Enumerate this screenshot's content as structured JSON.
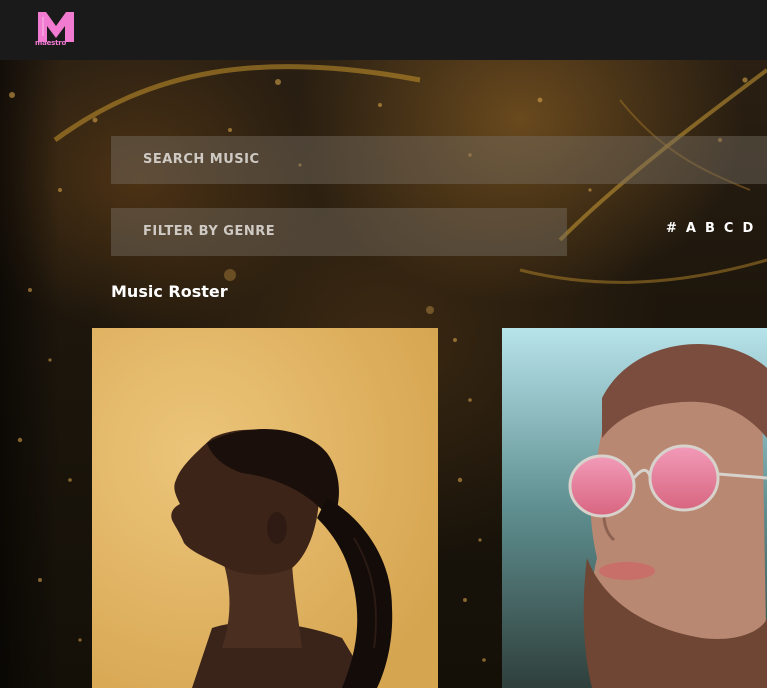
{
  "brand": {
    "logo_text": "maestro"
  },
  "search": {
    "placeholder": "SEARCH MUSIC"
  },
  "genre_filter": {
    "placeholder": "FILTER BY GENRE"
  },
  "alpha_nav": [
    "#",
    "A",
    "B",
    "C",
    "D"
  ],
  "roster": {
    "title": "Music Roster",
    "artists": [
      {
        "photo": "woman-profile-ponytail-on-gold-background"
      },
      {
        "photo": "bearded-man-pink-round-sunglasses"
      }
    ]
  },
  "colors": {
    "brand_pink": "#f07bd0",
    "card1_bg": "#e0b565",
    "topbar_bg": "#1a1a1a"
  }
}
